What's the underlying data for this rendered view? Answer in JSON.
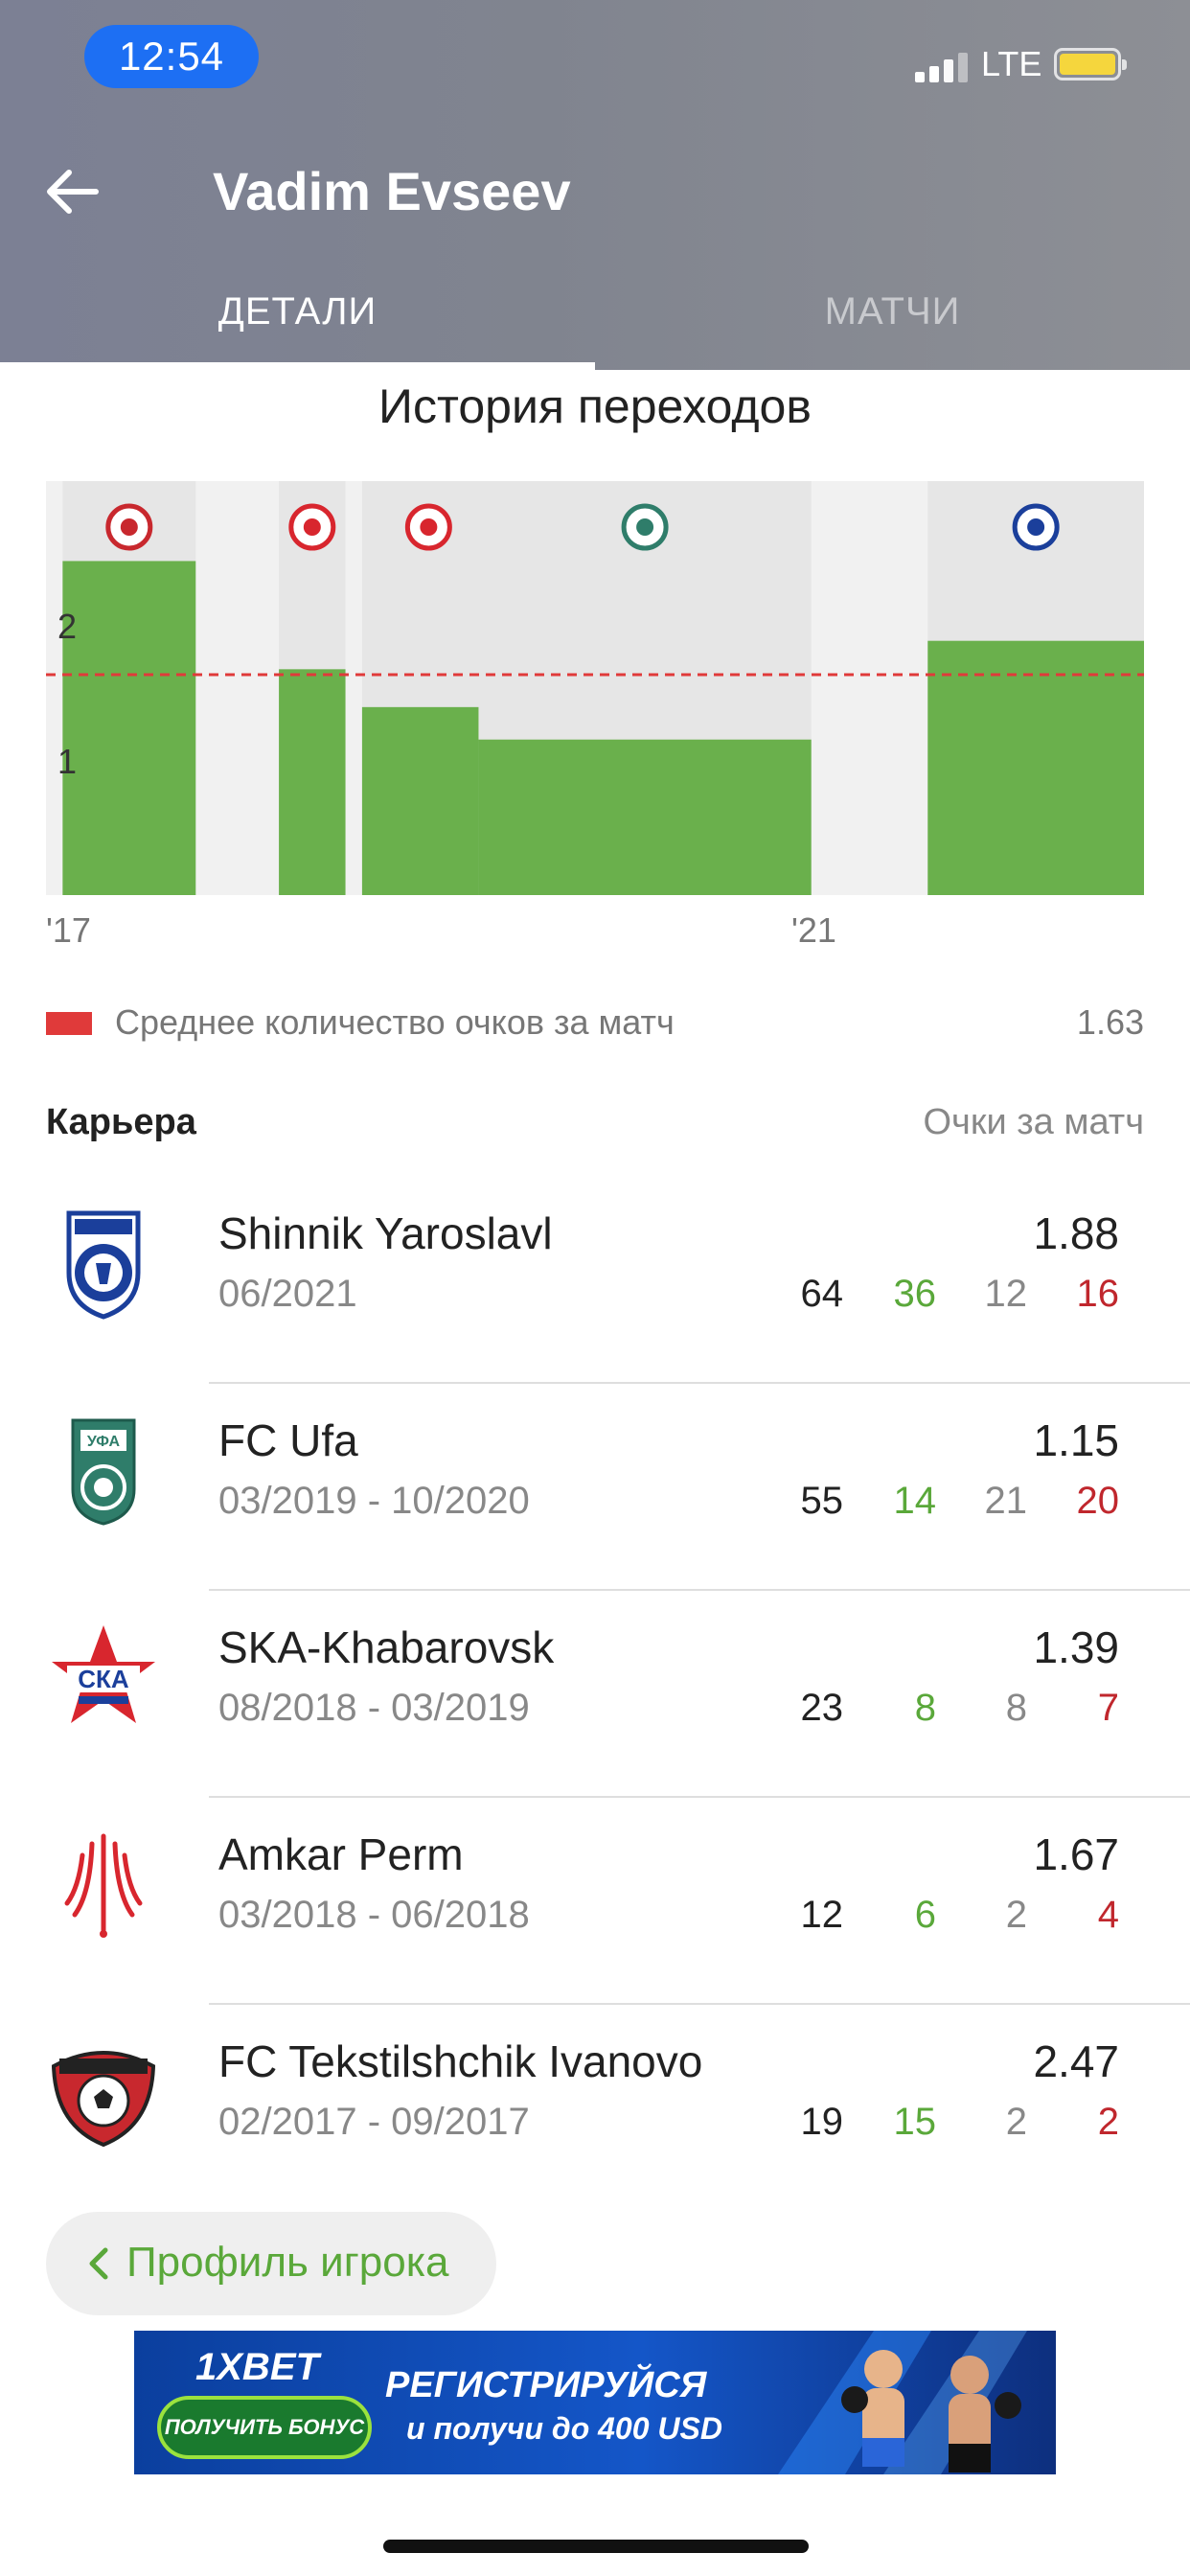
{
  "status_bar": {
    "time": "12:54",
    "network": "LTE"
  },
  "header": {
    "title": "Vadim Evseev"
  },
  "tabs": [
    {
      "label": "ДЕТАЛИ",
      "active": true
    },
    {
      "label": "МАТЧИ",
      "active": false
    }
  ],
  "transfer_history": {
    "title": "История переходов",
    "year_labels": [
      "'17",
      "'21"
    ],
    "legend_label": "Среднее количество очков за матч",
    "legend_value": "1.63",
    "legend_color": "#e03a3a"
  },
  "chart_data": {
    "type": "bar",
    "y_ticks": [
      "1",
      "2"
    ],
    "ylim": [
      0,
      3
    ],
    "average": 1.63,
    "bar_color": "#6ab04c",
    "background_color": "#e6e6e6",
    "periods": [
      {
        "team": "FC Tekstilshchik Ivanovo",
        "start": "2017-02",
        "end": "2017-09",
        "value": 2.47,
        "logo": "tekstilshchik-logo"
      },
      {
        "team": "Amkar Perm",
        "start": "2018-03",
        "end": "2018-06",
        "value": 1.67,
        "logo": "amkar-logo"
      },
      {
        "team": "SKA-Khabarovsk",
        "start": "2018-08",
        "end": "2019-03",
        "value": 1.39,
        "logo": "ska-logo"
      },
      {
        "team": "FC Ufa",
        "start": "2019-03",
        "end": "2020-10",
        "value": 1.15,
        "logo": "ufa-logo"
      },
      {
        "team": "Shinnik Yaroslavl",
        "start": "2021-06",
        "end": "",
        "value": 1.88,
        "logo": "shinnik-logo"
      }
    ]
  },
  "career": {
    "title": "Карьера",
    "column_label": "Очки за матч",
    "rows": [
      {
        "team": "Shinnik Yaroslavl",
        "period": "06/2021",
        "ppm": "1.88",
        "games": "64",
        "wins": "36",
        "draws": "12",
        "losses": "16",
        "logo": "shinnik-logo"
      },
      {
        "team": "FC Ufa",
        "period": "03/2019 - 10/2020",
        "ppm": "1.15",
        "games": "55",
        "wins": "14",
        "draws": "21",
        "losses": "20",
        "logo": "ufa-logo"
      },
      {
        "team": "SKA-Khabarovsk",
        "period": "08/2018 - 03/2019",
        "ppm": "1.39",
        "games": "23",
        "wins": "8",
        "draws": "8",
        "losses": "7",
        "logo": "ska-logo"
      },
      {
        "team": "Amkar Perm",
        "period": "03/2018 - 06/2018",
        "ppm": "1.67",
        "games": "12",
        "wins": "6",
        "draws": "2",
        "losses": "4",
        "logo": "amkar-logo"
      },
      {
        "team": "FC Tekstilshchik Ivanovo",
        "period": "02/2017 - 09/2017",
        "ppm": "2.47",
        "games": "19",
        "wins": "15",
        "draws": "2",
        "losses": "2",
        "logo": "tekstilshchik-logo"
      }
    ]
  },
  "profile_button": {
    "label": "Профиль игрока"
  },
  "banner": {
    "brand": "1XBET",
    "button_label": "ПОЛУЧИТЬ БОНУС",
    "headline": "РЕГИСТРИРУЙСЯ",
    "subline": "и получи до 400 USD"
  },
  "colors": {
    "accent_green": "#5aa83a",
    "loss_red": "#c0272d",
    "header_gray": "#80848f",
    "time_pill_blue": "#1d6ff3"
  }
}
